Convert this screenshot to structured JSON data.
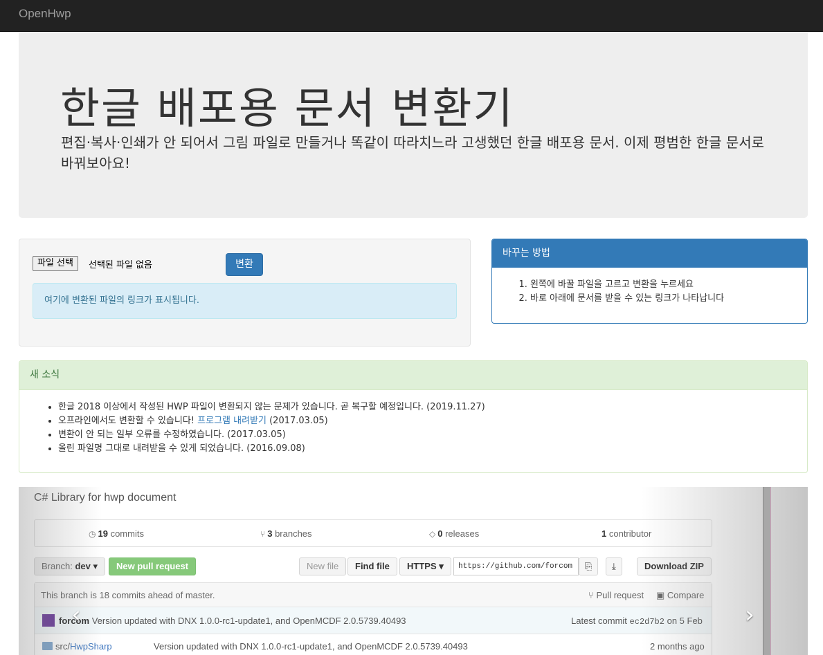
{
  "navbar": {
    "brand": "OpenHwp"
  },
  "jumbotron": {
    "title": "한글 배포용 문서 변환기",
    "lead": "편집·복사·인쇄가 안 되어서 그림 파일로 만들거나 똑같이 따라치느라 고생했던 한글 배포용 문서. 이제 평범한 한글 문서로 바꿔보아요!"
  },
  "converter": {
    "file_button": "파일 선택",
    "file_status": "선택된 파일 없음",
    "convert_button": "변환",
    "result_placeholder": "여기에 변환된 파일의 링크가 표시됩니다."
  },
  "how_to": {
    "title": "바꾸는 방법",
    "steps": [
      "왼쪽에 바꿀 파일을 고르고 변환을 누르세요",
      "바로 아래에 문서를 받을 수 있는 링크가 나타납니다"
    ]
  },
  "news": {
    "title": "새 소식",
    "items": [
      {
        "text": "한글 2018 이상에서 작성된 HWP 파일이 변환되지 않는 문제가 있습니다. 곧 복구할 예정입니다. (2019.11.27)"
      },
      {
        "text": "오프라인에서도 변환할 수 있습니다! ",
        "link": "프로그램 내려받기",
        "suffix": " (2017.03.05)"
      },
      {
        "text": "변환이 안 되는 일부 오류를 수정하였습니다. (2017.03.05)"
      },
      {
        "text": "올린 파일명 그대로 내려받을 수 있게 되었습니다. (2016.09.08)"
      }
    ]
  },
  "carousel": {
    "description": "C# Library for hwp document",
    "stats": {
      "commits_count": "19",
      "commits_label": "commits",
      "branches_count": "3",
      "branches_label": "branches",
      "releases_count": "0",
      "releases_label": "releases",
      "contributors_count": "1",
      "contributors_label": "contributor"
    },
    "toolbar": {
      "branch_label": "Branch:",
      "branch_name": "dev",
      "new_pull_request": "New pull request",
      "new_file": "New file",
      "find_file": "Find file",
      "protocol": "HTTPS",
      "clone_url": "https://github.com/forcom",
      "download_zip": "Download ZIP"
    },
    "branch_info": {
      "text": "This branch is 18 commits ahead of master.",
      "pull_request": "Pull request",
      "compare": "Compare"
    },
    "latest_commit": {
      "author": "forcom",
      "message": "Version updated with DNX 1.0.0-rc1-update1, and OpenMCDF 2.0.5739.40493",
      "label": "Latest commit",
      "sha": "ec2d7b2",
      "date": "on 5 Feb"
    },
    "file_row": {
      "dir": "src/",
      "name": "HwpSharp",
      "message": "Version updated with DNX 1.0.0-rc1-update1, and OpenMCDF 2.0.5739.40493",
      "age": "2 months ago"
    },
    "prev": "‹",
    "next": "›"
  },
  "colors": {
    "primary": "#337ab7",
    "info_bg": "#d9edf7",
    "success_bg": "#dff0d8",
    "navbar": "#222222"
  }
}
